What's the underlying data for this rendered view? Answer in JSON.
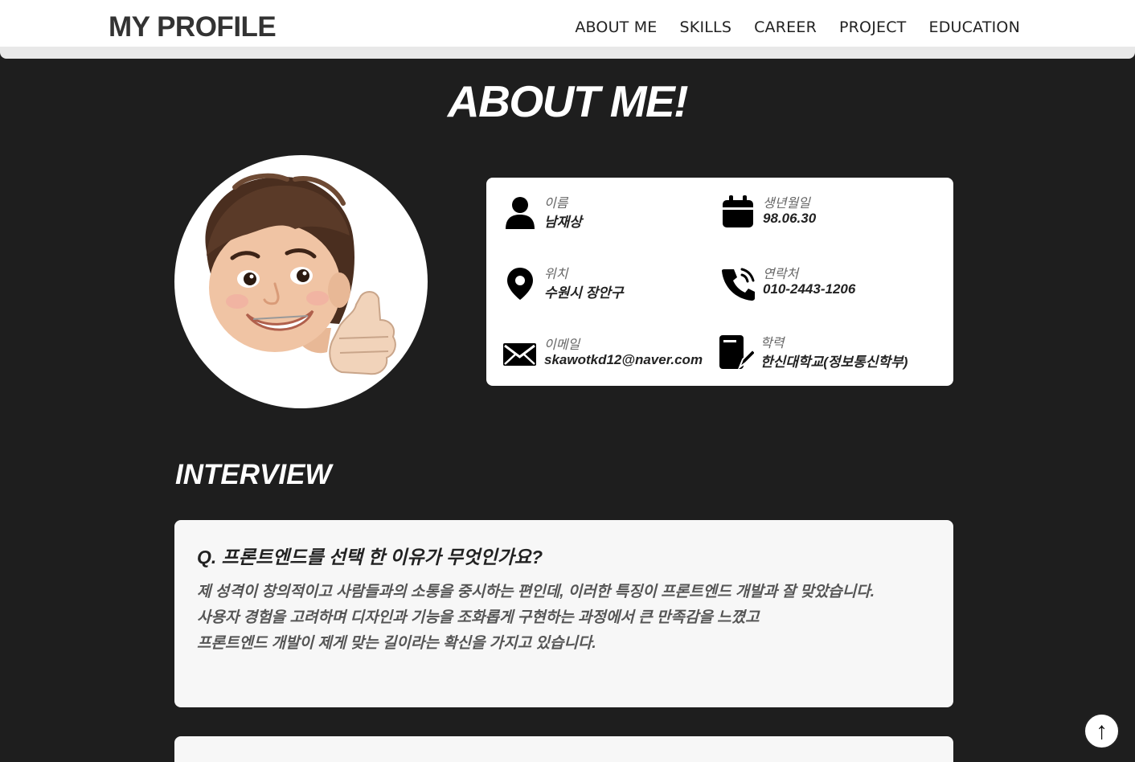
{
  "header": {
    "logo": "MY PROFILE",
    "nav": [
      "ABOUT ME",
      "SKILLS",
      "CAREER",
      "PROJECT",
      "EDUCATION"
    ]
  },
  "page_title": "ABOUT ME!",
  "info": {
    "name": {
      "label": "이름",
      "value": "남재상",
      "icon": "person-icon"
    },
    "birth": {
      "label": "생년월일",
      "value": "98.06.30",
      "icon": "calendar-icon"
    },
    "location": {
      "label": "위치",
      "value": "수원시 장안구",
      "icon": "location-pin-icon"
    },
    "phone": {
      "label": "연락처",
      "value": "010-2443-1206",
      "icon": "phone-icon"
    },
    "email": {
      "label": "이메일",
      "value": "skawotkd12@naver.com",
      "icon": "mail-icon"
    },
    "education": {
      "label": "학력",
      "value": "한신대학교(정보통신학부)",
      "icon": "document-edit-icon"
    }
  },
  "interview": {
    "title": "INTERVIEW",
    "items": [
      {
        "question": "Q. 프론트엔드를 선택 한 이유가 무엇인가요?",
        "answer_lines": [
          "제 성격이 창의적이고 사람들과의 소통을 중시하는 편인데, 이러한 특징이 프론트엔드 개발과 잘 맞았습니다.",
          "사용자 경험을 고려하며 디자인과 기능을 조화롭게 구현하는 과정에서 큰 만족감을 느꼈고",
          "프론트엔드 개발이 제게 맞는 길이라는 확신을 가지고 있습니다."
        ]
      }
    ]
  },
  "top_button": "↑",
  "colors": {
    "background": "#1e1e1e",
    "card": "#ffffff",
    "qa_card": "#f7f7f7"
  }
}
